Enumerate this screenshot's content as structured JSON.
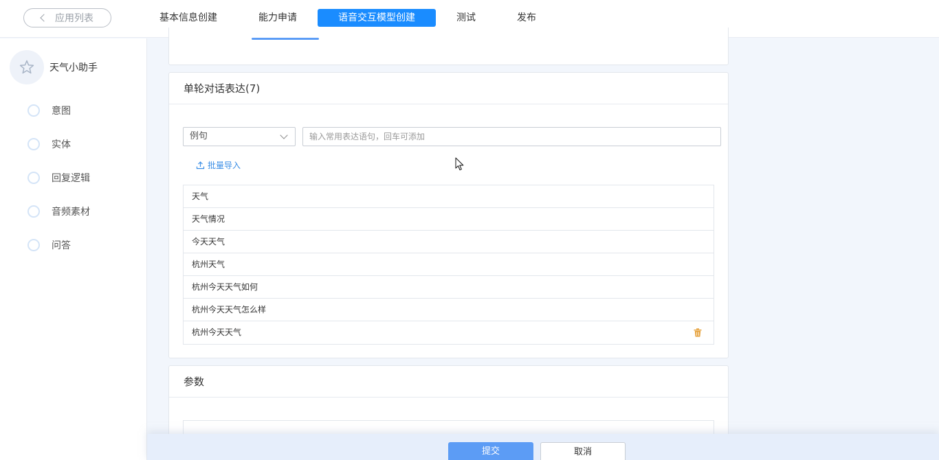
{
  "topbar": {
    "back_label": "应用列表",
    "tabs": [
      {
        "label": "基本信息创建",
        "active": false
      },
      {
        "label": "能力申请",
        "active": false
      },
      {
        "label": "语音交互模型创建",
        "active": true
      },
      {
        "label": "测试",
        "active": false
      },
      {
        "label": "发布",
        "active": false
      }
    ]
  },
  "sidebar": {
    "app_name": "天气小助手",
    "app_icon": "star-icon",
    "items": [
      {
        "label": "意图"
      },
      {
        "label": "实体"
      },
      {
        "label": "回复逻辑"
      },
      {
        "label": "音频素材"
      },
      {
        "label": "问答"
      }
    ]
  },
  "expressions_card": {
    "title": "单轮对话表达(7)",
    "type_select": "例句",
    "input_placeholder": "输入常用表达语句，回车可添加",
    "import_label": "批量导入",
    "rows": [
      "天气",
      "天气情况",
      "今天天气",
      "杭州天气",
      "杭州今天天气如何",
      "杭州今天天气怎么样",
      "杭州今天天气"
    ]
  },
  "params_card": {
    "title": "参数"
  },
  "footer": {
    "submit_label": "提交",
    "cancel_label": "取消"
  },
  "colors": {
    "accent": "#1a8cff",
    "submit": "#5c9cf5",
    "link": "#3a8ee6",
    "trash": "#e6a23c"
  }
}
